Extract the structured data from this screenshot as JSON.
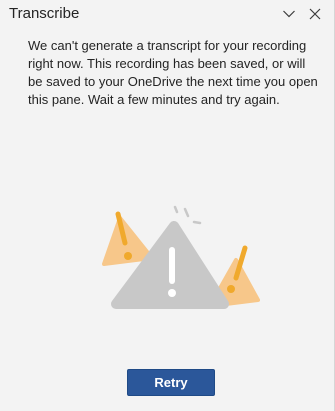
{
  "pane": {
    "title": "Transcribe",
    "collapse_icon": "chevron-down-icon",
    "close_icon": "close-icon"
  },
  "message": {
    "text": "We can't generate a transcript for your recording right now. This recording has been saved, or will be saved to your OneDrive the next time you open this pane. Wait a few minutes and try again."
  },
  "illustration": {
    "icon": "warning-triangles-illustration",
    "colors": {
      "main_triangle": "#c8c8c8",
      "exclamation": "#ffffff",
      "accent_triangle": "#f7c78a",
      "accent_mark": "#f0a92c",
      "sparks": "#c8c8c8"
    }
  },
  "actions": {
    "retry_label": "Retry",
    "retry_color": "#2b579a"
  }
}
